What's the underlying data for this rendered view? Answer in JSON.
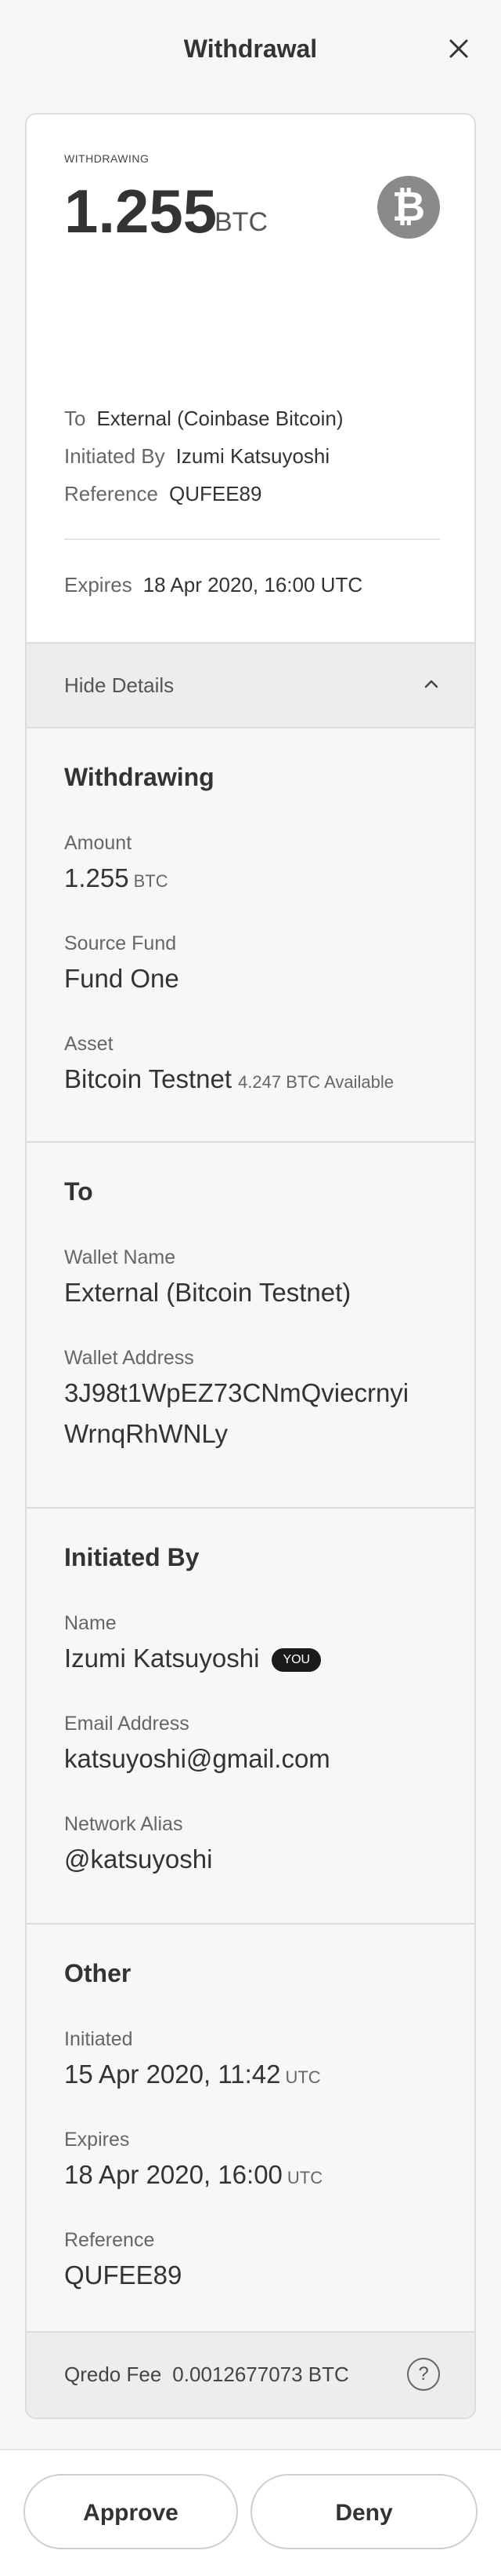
{
  "header": {
    "title": "Withdrawal"
  },
  "summary": {
    "label": "WITHDRAWING",
    "amount": "1.255",
    "unit": "BTC",
    "to_label": "To",
    "to_value": "External (Coinbase Bitcoin)",
    "initiated_label": "Initiated By",
    "initiated_value": "Izumi Katsuyoshi",
    "reference_label": "Reference",
    "reference_value": "QUFEE89",
    "expires_label": "Expires",
    "expires_value": "18 Apr 2020, 16:00 UTC"
  },
  "toggle": {
    "label": "Hide Details"
  },
  "withdrawing": {
    "title": "Withdrawing",
    "amount_label": "Amount",
    "amount_value": "1.255",
    "amount_unit": "BTC",
    "fund_label": "Source Fund",
    "fund_value": "Fund One",
    "asset_label": "Asset",
    "asset_value": "Bitcoin Testnet",
    "asset_note": "4.247 BTC Available"
  },
  "to": {
    "title": "To",
    "wallet_name_label": "Wallet Name",
    "wallet_name_value": "External (Bitcoin Testnet)",
    "wallet_address_label": "Wallet Address",
    "wallet_address_line1": "3J98t1WpEZ73CNmQviecrnyi",
    "wallet_address_line2": "WrnqRhWNLy"
  },
  "initiated_by": {
    "title": "Initiated By",
    "name_label": "Name",
    "name_value": "Izumi Katsuyoshi",
    "you_badge": "YOU",
    "email_label": "Email Address",
    "email_value": "katsuyoshi@gmail.com",
    "alias_label": "Network Alias",
    "alias_value": "@katsuyoshi"
  },
  "other": {
    "title": "Other",
    "initiated_label": "Initiated",
    "initiated_value": "15 Apr 2020, 11:42",
    "initiated_unit": "UTC",
    "expires_label": "Expires",
    "expires_value": "18 Apr 2020, 16:00",
    "expires_unit": "UTC",
    "reference_label": "Reference",
    "reference_value": "QUFEE89"
  },
  "fee": {
    "label": "Qredo Fee",
    "value": "0.0012677073 BTC"
  },
  "actions": {
    "approve": "Approve",
    "deny": "Deny"
  },
  "colors": {
    "badge_bg": "#8a8a8a",
    "you_badge_bg": "#1a1a1a"
  },
  "icons": {
    "close": "close-icon",
    "bitcoin": "bitcoin-icon",
    "chevron": "chevron-up-icon",
    "help": "help-icon"
  }
}
